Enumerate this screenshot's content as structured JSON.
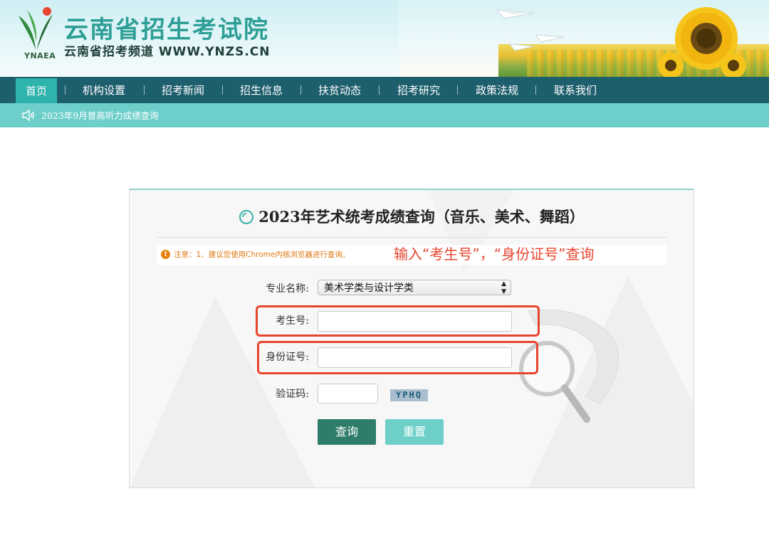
{
  "header": {
    "title": "云南省招生考试院",
    "subtitle": "云南省招考频道 WWW.YNZS.CN",
    "logo_text": "YNAEA"
  },
  "nav": {
    "items": [
      {
        "label": "首页",
        "active": true
      },
      {
        "label": "机构设置"
      },
      {
        "label": "招考新闻"
      },
      {
        "label": "招生信息"
      },
      {
        "label": "扶贫动态"
      },
      {
        "label": "招考研究"
      },
      {
        "label": "政策法规"
      },
      {
        "label": "联系我们"
      }
    ]
  },
  "notice": {
    "icon": "speaker-icon",
    "text": "2023年9月普高听力成绩查询"
  },
  "form": {
    "title": "2023年艺术统考成绩查询（音乐、美术、舞蹈）",
    "tip": "注意：1、建议您使用Chrome内核浏览器进行查询。",
    "annotation": "输入“考生号”，“身份证号”查询",
    "major_label": "专业名称:",
    "major_value": "美术学类与设计学类",
    "exam_no_label": "考生号:",
    "exam_no_value": "",
    "id_no_label": "身份证号:",
    "id_no_value": "",
    "captcha_label": "验证码:",
    "captcha_value": "",
    "captcha_image_text": "YPHQ",
    "query_button": "查询",
    "reset_button": "重置"
  },
  "colors": {
    "nav_bg": "#1e5f6d",
    "nav_active": "#2fb3ad",
    "notice_bg": "#6ecfca",
    "query_btn": "#2e7d6a",
    "reset_btn": "#6ed0c9",
    "highlight": "#e8452e",
    "tip": "#e0780f"
  }
}
